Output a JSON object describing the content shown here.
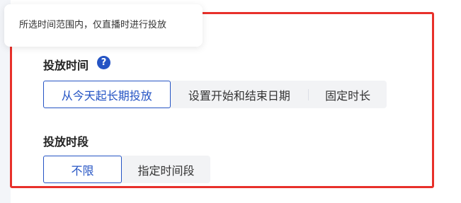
{
  "tooltip": {
    "text": "所选时间范围内，仅直播时进行投放"
  },
  "schedule_time": {
    "title": "投放时间",
    "help_icon": "question-circle-icon",
    "help_symbol": "?",
    "options": [
      {
        "label": "从今天起长期投放",
        "selected": true
      },
      {
        "label": "设置开始和结束日期",
        "selected": false
      },
      {
        "label": "固定时长",
        "selected": false
      }
    ]
  },
  "time_slot": {
    "title": "投放时段",
    "options": [
      {
        "label": "不限",
        "selected": true
      },
      {
        "label": "指定时间段",
        "selected": false
      }
    ]
  },
  "colors": {
    "accent": "#2554c4",
    "highlight_border": "#e8302a",
    "segment_bg": "#f2f3f5"
  }
}
